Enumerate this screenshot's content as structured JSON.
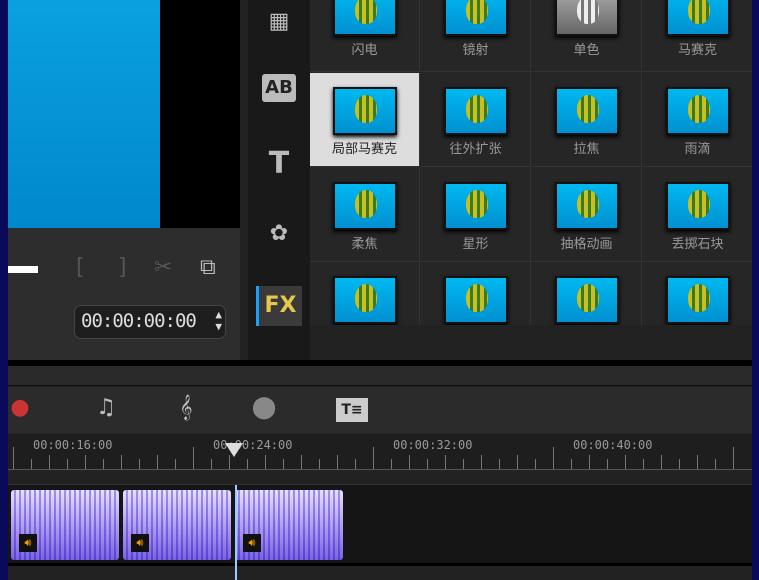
{
  "preview": {
    "timecode": "00:00:00:00",
    "mark_in": "[",
    "mark_out": "]",
    "cut_icon": "scissors-icon",
    "copy_icon": "copy-icon"
  },
  "categories": [
    {
      "icon": "magic-title-icon",
      "label": ""
    },
    {
      "icon": "transition-icon",
      "label": "AB"
    },
    {
      "icon": "title-icon",
      "label": "T"
    },
    {
      "icon": "graphic-icon",
      "label": ""
    },
    {
      "icon": "filter-icon",
      "label": "FX"
    }
  ],
  "filters": [
    "闪电",
    "镜射",
    "单色",
    "马赛克",
    "局部马赛克",
    "往外扩张",
    "拉焦",
    "雨滴",
    "柔焦",
    "星形",
    "抽格动画",
    "丢掷石块",
    "",
    "",
    "",
    ""
  ],
  "selected_filter": "局部马赛克",
  "toolbar": [
    "record-capture-icon",
    "sound-mixer-icon",
    "auto-music-icon",
    "motion-tracking-icon",
    "subtitle-editor-icon"
  ],
  "ruler": {
    "labels": [
      "00:00:16:00",
      "00:00:24:00",
      "00:00:32:00",
      "00:00:40:00"
    ]
  },
  "clips": [
    {
      "type": "video",
      "audio": true
    },
    {
      "type": "video",
      "audio": true
    },
    {
      "type": "video",
      "audio": true
    }
  ]
}
